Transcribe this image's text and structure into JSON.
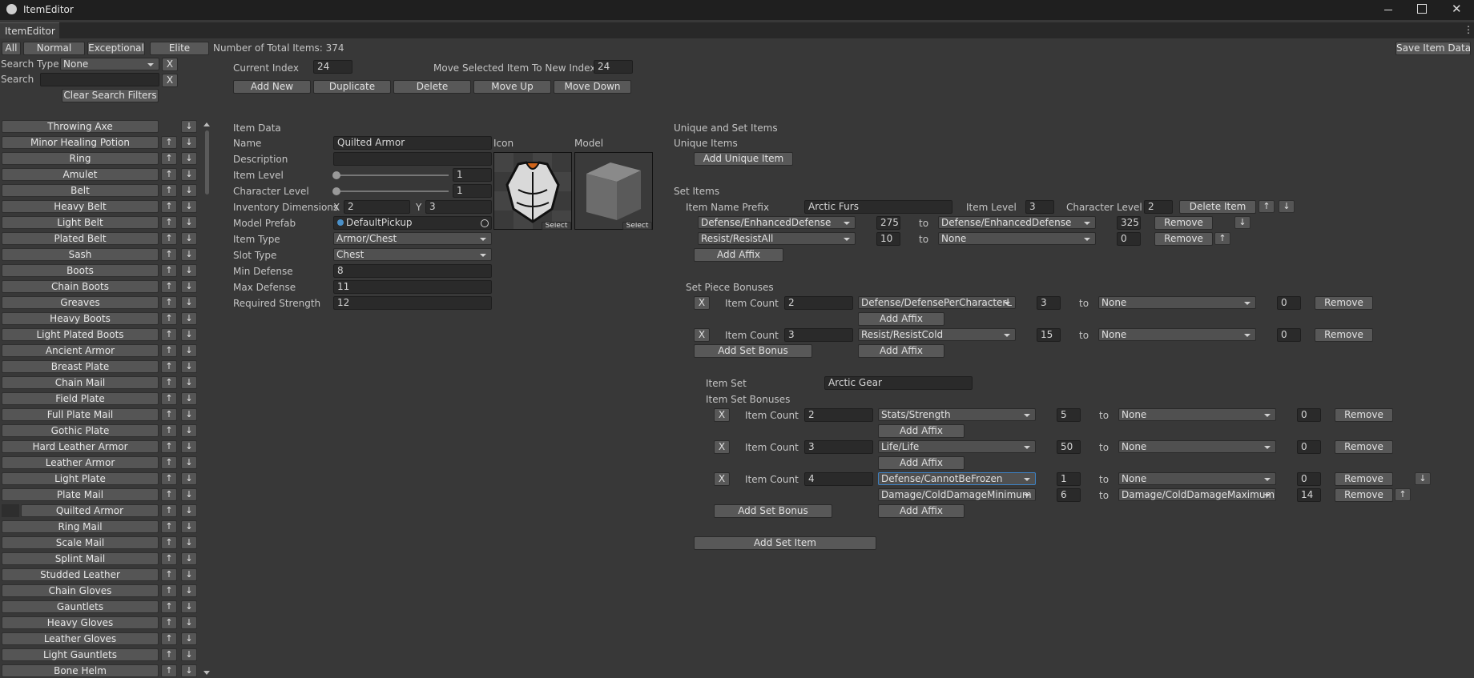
{
  "window": {
    "title": "ItemEditor"
  },
  "tab": {
    "label": "ItemEditor"
  },
  "top": {
    "filter_all": "All",
    "filter_normal": "Normal",
    "filter_exceptional": "Exceptional",
    "filter_elite": "Elite",
    "total_items": "Number of Total Items: 374",
    "save": "Save Item Data",
    "menu_icon": "⋮"
  },
  "search": {
    "type_label": "Search Type",
    "type_value": "None",
    "search_label": "Search",
    "search_value": "",
    "x": "X",
    "clear": "Clear Search Filters"
  },
  "controls": {
    "current_index_label": "Current Index",
    "current_index_value": "24",
    "move_label": "Move Selected Item To New Index",
    "move_value": "24",
    "add_new": "Add New",
    "duplicate": "Duplicate",
    "delete": "Delete",
    "move_up": "Move Up",
    "move_down": "Move Down"
  },
  "items": [
    "Throwing Axe",
    "Minor Healing Potion",
    "Ring",
    "Amulet",
    "Belt",
    "Heavy Belt",
    "Light Belt",
    "Plated Belt",
    "Sash",
    "Boots",
    "Chain Boots",
    "Greaves",
    "Heavy Boots",
    "Light Plated Boots",
    "Ancient Armor",
    "Breast Plate",
    "Chain Mail",
    "Field Plate",
    "Full Plate Mail",
    "Gothic Plate",
    "Hard Leather Armor",
    "Leather Armor",
    "Light Plate",
    "Plate Mail",
    "Quilted Armor",
    "Ring Mail",
    "Scale Mail",
    "Splint Mail",
    "Studded Leather",
    "Chain Gloves",
    "Gauntlets",
    "Heavy Gloves",
    "Leather Gloves",
    "Light Gauntlets",
    "Bone Helm"
  ],
  "item_data": {
    "header": "Item Data",
    "name_label": "Name",
    "name_value": "Quilted Armor",
    "desc_label": "Description",
    "desc_value": "",
    "item_level_label": "Item Level",
    "item_level_value": "1",
    "char_level_label": "Character Level",
    "char_level_value": "1",
    "inv_label": "Inventory Dimensions",
    "x_label": "X",
    "x_value": "2",
    "y_label": "Y",
    "y_value": "3",
    "prefab_label": "Model Prefab",
    "prefab_value": "DefaultPickup",
    "type_label": "Item Type",
    "type_value": "Armor/Chest",
    "slot_label": "Slot Type",
    "slot_value": "Chest",
    "min_def_label": "Min Defense",
    "min_def_value": "8",
    "max_def_label": "Max Defense",
    "max_def_value": "11",
    "req_str_label": "Required Strength",
    "req_str_value": "12",
    "icon_label": "Icon",
    "model_label": "Model",
    "select": "Select"
  },
  "unique": {
    "header": "Unique and Set Items",
    "unique_label": "Unique Items",
    "add_unique": "Add Unique Item"
  },
  "set_items": {
    "label": "Set Items",
    "prefix_label": "Item Name Prefix",
    "prefix_value": "Arctic Furs",
    "item_level_label": "Item Level",
    "item_level_value": "3",
    "char_level_label": "Character Level",
    "char_level_value": "2",
    "delete_item": "Delete Item",
    "affixes": [
      {
        "a": "Defense/EnhancedDefense",
        "av": "275",
        "to": "to",
        "b": "Defense/EnhancedDefense",
        "bv": "325",
        "remove": "Remove"
      },
      {
        "a": "Resist/ResistAll",
        "av": "10",
        "to": "to",
        "b": "None",
        "bv": "0",
        "remove": "Remove"
      }
    ],
    "add_affix": "Add Affix",
    "piece_bonuses_label": "Set Piece Bonuses",
    "piece_bonuses": [
      {
        "x": "X",
        "count_label": "Item Count",
        "count": "2",
        "a": "Defense/DefensePerCharacterL",
        "av": "3",
        "to": "to",
        "b": "None",
        "bv": "0",
        "remove": "Remove",
        "add_affix": "Add Affix"
      },
      {
        "x": "X",
        "count_label": "Item Count",
        "count": "3",
        "a": "Resist/ResistCold",
        "av": "15",
        "to": "to",
        "b": "None",
        "bv": "0",
        "remove": "Remove",
        "add_affix": "Add Affix"
      }
    ],
    "add_set_bonus": "Add Set Bonus",
    "item_set_label": "Item Set",
    "item_set_value": "Arctic Gear",
    "set_bonuses_label": "Item Set Bonuses",
    "set_bonuses": [
      {
        "x": "X",
        "count_label": "Item Count",
        "count": "2",
        "a": "Stats/Strength",
        "av": "5",
        "to": "to",
        "b": "None",
        "bv": "0",
        "remove": "Remove",
        "add_affix": "Add Affix"
      },
      {
        "x": "X",
        "count_label": "Item Count",
        "count": "3",
        "a": "Life/Life",
        "av": "50",
        "to": "to",
        "b": "None",
        "bv": "0",
        "remove": "Remove",
        "add_affix": "Add Affix"
      },
      {
        "x": "X",
        "count_label": "Item Count",
        "count": "4",
        "a": "Defense/CannotBeFrozen",
        "av": "1",
        "to": "to",
        "b": "None",
        "bv": "0",
        "remove": "Remove",
        "a2": "Damage/ColdDamageMinimum",
        "av2": "6",
        "b2": "Damage/ColdDamageMaximum",
        "bv2": "14",
        "add_affix": "Add Affix"
      }
    ],
    "add_set_item": "Add Set Item"
  },
  "arrows": {
    "up": "↑",
    "down": "↓"
  }
}
